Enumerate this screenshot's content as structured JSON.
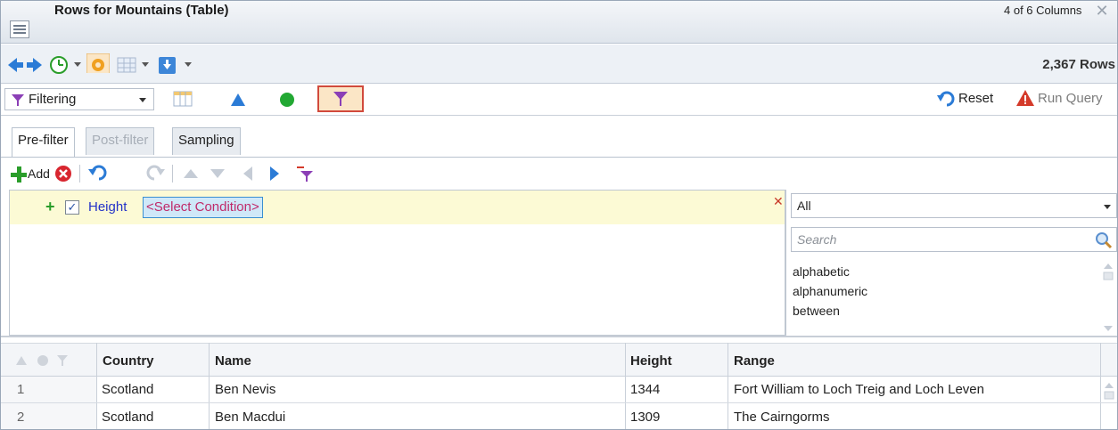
{
  "window": {
    "title": "Rows for Mountains (Table)",
    "column_status": "4 of 6 Columns",
    "close_glyph": "✕"
  },
  "navbar": {
    "row_count": "2,367 Rows"
  },
  "filterbar": {
    "mode_select_value": "Filtering",
    "reset_label": "Reset",
    "run_query_label": "Run Query"
  },
  "tabs": [
    {
      "label": "Pre-filter",
      "state": "active"
    },
    {
      "label": "Post-filter",
      "state": "disabled"
    },
    {
      "label": "Sampling",
      "state": "normal"
    }
  ],
  "condbar": {
    "add_label": "Add"
  },
  "condition": {
    "checked": true,
    "field": "Height",
    "placeholder": "<Select Condition>"
  },
  "chooser": {
    "category_value": "All",
    "search_placeholder": "Search",
    "items": [
      "alphabetic",
      "alphanumeric",
      "between"
    ]
  },
  "table": {
    "columns": [
      "Country",
      "Name",
      "Height",
      "Range"
    ],
    "rows": [
      {
        "num": "1",
        "Country": "Scotland",
        "Name": "Ben Nevis",
        "Height": "1344",
        "Range": "Fort William to Loch Treig and Loch Leven"
      },
      {
        "num": "2",
        "Country": "Scotland",
        "Name": "Ben Macdui",
        "Height": "1309",
        "Range": "The Cairngorms"
      }
    ]
  },
  "colors": {
    "accent_blue": "#2b7bd6",
    "filter_purple": "#8b3fb6",
    "selected_row_yellow": "#fcfad5",
    "warning_red": "#d43a2a",
    "add_green": "#2a9d2a"
  }
}
